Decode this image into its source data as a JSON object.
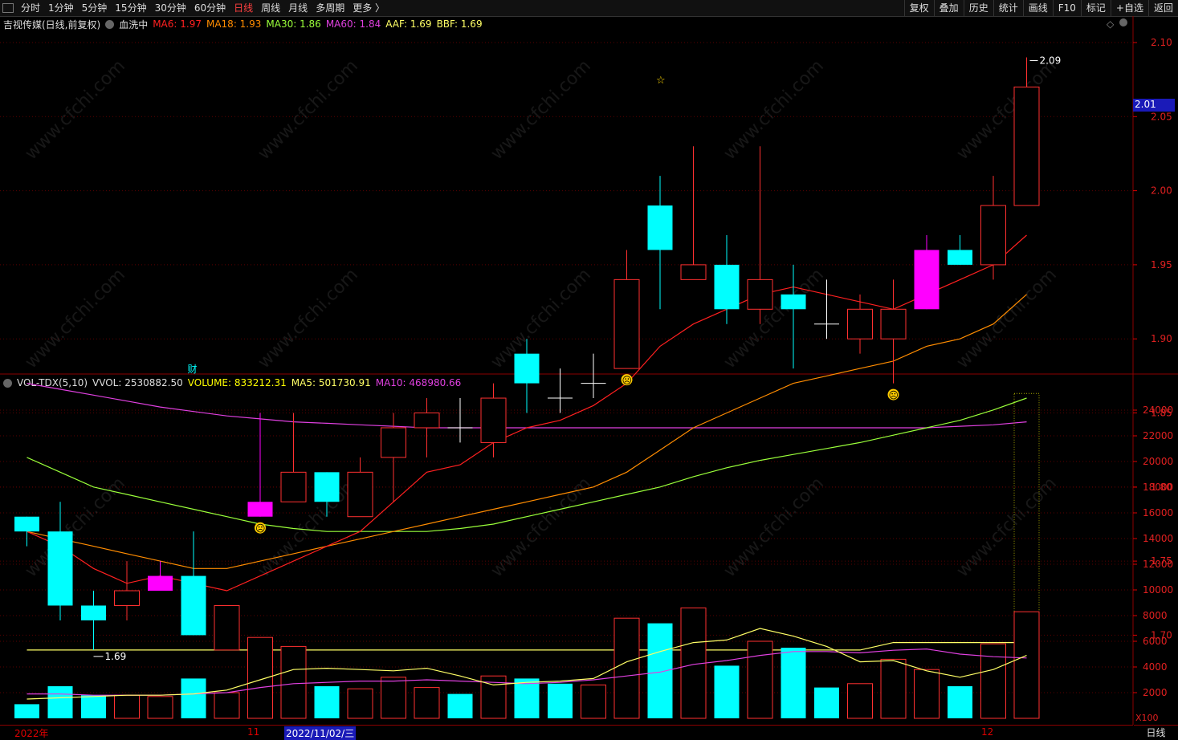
{
  "toolbar": {
    "periods": [
      "分时",
      "1分钟",
      "5分钟",
      "15分钟",
      "30分钟",
      "60分钟",
      "日线",
      "周线",
      "月线",
      "多周期",
      "更多 〉"
    ],
    "active_period": "日线",
    "actions": [
      "复权",
      "叠加",
      "历史",
      "统计",
      "画线",
      "F10",
      "标记",
      "+自选",
      "返回"
    ]
  },
  "price_header": {
    "title": "吉视传媒(日线,前复权)",
    "indicator": "血洗中",
    "ma6": "MA6: 1.97",
    "ma18": "MA18: 1.93",
    "ma30": "MA30: 1.86",
    "ma60": "MA60: 1.84",
    "aaf": "AAF: 1.69",
    "bbf": "BBF: 1.69"
  },
  "vol_header": {
    "title": "VOL-TDX(5,10)",
    "vvol": "VVOL: 2530882.50",
    "volume": "VOLUME: 833212.31",
    "ma5": "MA5: 501730.91",
    "ma10": "MA10: 468980.66"
  },
  "x_axis": {
    "year": "2022年",
    "nov": "11",
    "cursor_date": "2022/11/02/三",
    "dec": "12"
  },
  "period_label": "日线",
  "current_price_tag": "2.01",
  "annotations": {
    "high": "2.09",
    "low": "1.69",
    "caiwu": "财",
    "star": "☆",
    "sad": "☹"
  },
  "colors": {
    "up": "#ff3030",
    "down": "#00ffff",
    "magenta": "#ff00ff",
    "ma6": "#ff2020",
    "ma18": "#ff8c00",
    "ma30": "#9aff3a",
    "ma60": "#e040e0",
    "aaf": "#ffff66",
    "vol_ma5": "#ffff66",
    "vol_ma10": "#e040e0"
  },
  "chart_data": [
    {
      "type": "candlestick",
      "y_ticks": [
        2.1,
        2.05,
        2.0,
        1.95,
        1.9,
        1.85,
        1.8,
        1.75,
        1.7
      ],
      "ylim": [
        1.67,
        2.115
      ],
      "candles": [
        {
          "o": 1.78,
          "h": 1.78,
          "l": 1.76,
          "c": 1.77,
          "c_kind": "down"
        },
        {
          "o": 1.77,
          "h": 1.79,
          "l": 1.71,
          "c": 1.72,
          "c_kind": "down"
        },
        {
          "o": 1.72,
          "h": 1.73,
          "l": 1.69,
          "c": 1.71,
          "c_kind": "down"
        },
        {
          "o": 1.72,
          "h": 1.75,
          "l": 1.71,
          "c": 1.73,
          "c_kind": "up"
        },
        {
          "o": 1.74,
          "h": 1.75,
          "l": 1.73,
          "c": 1.73,
          "c_kind": "magenta"
        },
        {
          "o": 1.74,
          "h": 1.77,
          "l": 1.7,
          "c": 1.7,
          "c_kind": "down"
        },
        {
          "o": 1.69,
          "h": 1.72,
          "l": 1.69,
          "c": 1.72,
          "c_kind": "up"
        },
        {
          "o": 1.79,
          "h": 1.85,
          "l": 1.78,
          "c": 1.78,
          "c_kind": "magenta"
        },
        {
          "o": 1.79,
          "h": 1.85,
          "l": 1.79,
          "c": 1.81,
          "c_kind": "up"
        },
        {
          "o": 1.81,
          "h": 1.81,
          "l": 1.78,
          "c": 1.79,
          "c_kind": "down"
        },
        {
          "o": 1.78,
          "h": 1.82,
          "l": 1.78,
          "c": 1.81,
          "c_kind": "up"
        },
        {
          "o": 1.82,
          "h": 1.85,
          "l": 1.79,
          "c": 1.84,
          "c_kind": "up"
        },
        {
          "o": 1.84,
          "h": 1.86,
          "l": 1.82,
          "c": 1.85,
          "c_kind": "up"
        },
        {
          "o": 1.84,
          "h": 1.86,
          "l": 1.83,
          "c": 1.84,
          "c_kind": "doji"
        },
        {
          "o": 1.83,
          "h": 1.87,
          "l": 1.82,
          "c": 1.86,
          "c_kind": "up"
        },
        {
          "o": 1.89,
          "h": 1.9,
          "l": 1.85,
          "c": 1.87,
          "c_kind": "down"
        },
        {
          "o": 1.86,
          "h": 1.88,
          "l": 1.85,
          "c": 1.86,
          "c_kind": "doji"
        },
        {
          "o": 1.87,
          "h": 1.89,
          "l": 1.86,
          "c": 1.87,
          "c_kind": "doji"
        },
        {
          "o": 1.88,
          "h": 1.96,
          "l": 1.88,
          "c": 1.94,
          "c_kind": "up"
        },
        {
          "o": 1.99,
          "h": 2.01,
          "l": 1.92,
          "c": 1.96,
          "c_kind": "down"
        },
        {
          "o": 1.94,
          "h": 2.03,
          "l": 1.94,
          "c": 1.95,
          "c_kind": "up"
        },
        {
          "o": 1.95,
          "h": 1.97,
          "l": 1.91,
          "c": 1.92,
          "c_kind": "down"
        },
        {
          "o": 1.92,
          "h": 2.03,
          "l": 1.91,
          "c": 1.94,
          "c_kind": "up"
        },
        {
          "o": 1.93,
          "h": 1.95,
          "l": 1.88,
          "c": 1.92,
          "c_kind": "down"
        },
        {
          "o": 1.91,
          "h": 1.94,
          "l": 1.9,
          "c": 1.91,
          "c_kind": "doji"
        },
        {
          "o": 1.9,
          "h": 1.93,
          "l": 1.89,
          "c": 1.92,
          "c_kind": "up"
        },
        {
          "o": 1.9,
          "h": 1.94,
          "l": 1.87,
          "c": 1.92,
          "c_kind": "up"
        },
        {
          "o": 1.92,
          "h": 1.97,
          "l": 1.92,
          "c": 1.96,
          "c_kind": "magenta"
        },
        {
          "o": 1.96,
          "h": 1.97,
          "l": 1.95,
          "c": 1.95,
          "c_kind": "down"
        },
        {
          "o": 1.95,
          "h": 2.01,
          "l": 1.94,
          "c": 1.99,
          "c_kind": "up"
        },
        {
          "o": 1.99,
          "h": 2.09,
          "l": 1.99,
          "c": 2.07,
          "c_kind": "up"
        }
      ],
      "ma6": [
        1.77,
        1.76,
        1.745,
        1.735,
        1.74,
        1.735,
        1.73,
        1.74,
        1.75,
        1.76,
        1.77,
        1.79,
        1.81,
        1.815,
        1.83,
        1.84,
        1.845,
        1.855,
        1.87,
        1.895,
        1.91,
        1.92,
        1.93,
        1.935,
        1.93,
        1.925,
        1.92,
        1.93,
        1.94,
        1.95,
        1.97
      ],
      "ma18": [
        1.77,
        1.765,
        1.76,
        1.755,
        1.75,
        1.745,
        1.745,
        1.75,
        1.755,
        1.76,
        1.765,
        1.77,
        1.775,
        1.78,
        1.785,
        1.79,
        1.795,
        1.8,
        1.81,
        1.825,
        1.84,
        1.85,
        1.86,
        1.87,
        1.875,
        1.88,
        1.885,
        1.895,
        1.9,
        1.91,
        1.93
      ],
      "ma30": [
        1.82,
        1.81,
        1.8,
        1.795,
        1.79,
        1.785,
        1.78,
        1.775,
        1.772,
        1.77,
        1.77,
        1.77,
        1.77,
        1.772,
        1.775,
        1.78,
        1.785,
        1.79,
        1.795,
        1.8,
        1.807,
        1.813,
        1.818,
        1.822,
        1.826,
        1.83,
        1.835,
        1.84,
        1.845,
        1.852,
        1.86
      ],
      "ma60": [
        1.87,
        1.866,
        1.862,
        1.858,
        1.854,
        1.851,
        1.848,
        1.846,
        1.844,
        1.843,
        1.842,
        1.841,
        1.84,
        1.84,
        1.84,
        1.84,
        1.84,
        1.84,
        1.84,
        1.84,
        1.84,
        1.84,
        1.84,
        1.84,
        1.84,
        1.84,
        1.84,
        1.84,
        1.841,
        1.842,
        1.844
      ],
      "aaf": [
        1.69,
        1.69,
        1.69,
        1.69,
        1.69,
        1.69,
        1.69,
        1.69,
        1.69,
        1.69,
        1.69,
        1.69,
        1.69,
        1.69,
        1.69,
        1.69,
        1.69,
        1.69,
        1.69,
        1.69,
        1.69,
        1.69,
        1.69,
        1.69,
        1.69,
        1.69,
        1.695,
        1.695,
        1.695,
        1.695,
        1.695
      ],
      "bbf": [
        1.69,
        1.69,
        1.69,
        1.69,
        1.69,
        1.69,
        1.69,
        1.69,
        1.69,
        1.69,
        1.69,
        1.69,
        1.69,
        1.69,
        1.69,
        1.69,
        1.69,
        1.69,
        1.69,
        1.69,
        1.69,
        1.69,
        1.69,
        1.69,
        1.69,
        1.69,
        1.69,
        1.69,
        1.69,
        1.69,
        1.69
      ],
      "aaf_bump": [
        25,
        26
      ],
      "markers": {
        "star_index": 19,
        "sad_indices": [
          7,
          18,
          26
        ],
        "caiwu_index": 5,
        "high_index": 30,
        "low_index": 2
      }
    },
    {
      "type": "bar",
      "title": "VOL-TDX(5,10)",
      "unit_label": "X100",
      "y_ticks": [
        24000,
        22000,
        20000,
        18000,
        16000,
        14000,
        12000,
        10000,
        8000,
        6000,
        4000,
        2000
      ],
      "ylim": [
        0,
        25700
      ],
      "volumes": [
        1100,
        2500,
        1800,
        1800,
        1700,
        3100,
        2000,
        6300,
        5600,
        2500,
        2300,
        3200,
        2400,
        1900,
        3300,
        3100,
        2700,
        2600,
        7800,
        7400,
        8600,
        4100,
        6000,
        5500,
        2400,
        2700,
        4600,
        3800,
        2500,
        5800,
        8300
      ],
      "vol_kind": [
        "down",
        "down",
        "down",
        "up",
        "up",
        "down",
        "up",
        "up",
        "up",
        "down",
        "up",
        "up",
        "up",
        "down",
        "up",
        "down",
        "down",
        "up",
        "up",
        "down",
        "up",
        "down",
        "up",
        "down",
        "down",
        "up",
        "up",
        "up",
        "down",
        "up",
        "up"
      ],
      "ma5": [
        1500,
        1600,
        1700,
        1800,
        1800,
        1900,
        2200,
        3000,
        3800,
        3900,
        3800,
        3700,
        3900,
        3300,
        2600,
        2800,
        2900,
        3100,
        4400,
        5200,
        5900,
        6100,
        7000,
        6400,
        5600,
        4400,
        4500,
        3700,
        3200,
        3800,
        4900
      ],
      "ma10": [
        1900,
        1900,
        1800,
        1800,
        1800,
        1900,
        2000,
        2400,
        2700,
        2800,
        2900,
        2900,
        3000,
        2900,
        2800,
        2700,
        2800,
        3000,
        3300,
        3600,
        4200,
        4500,
        4900,
        5200,
        5200,
        5100,
        5300,
        5400,
        5000,
        4800,
        4700
      ],
      "ghost_bar": {
        "index": 30,
        "value": 25300
      }
    }
  ]
}
